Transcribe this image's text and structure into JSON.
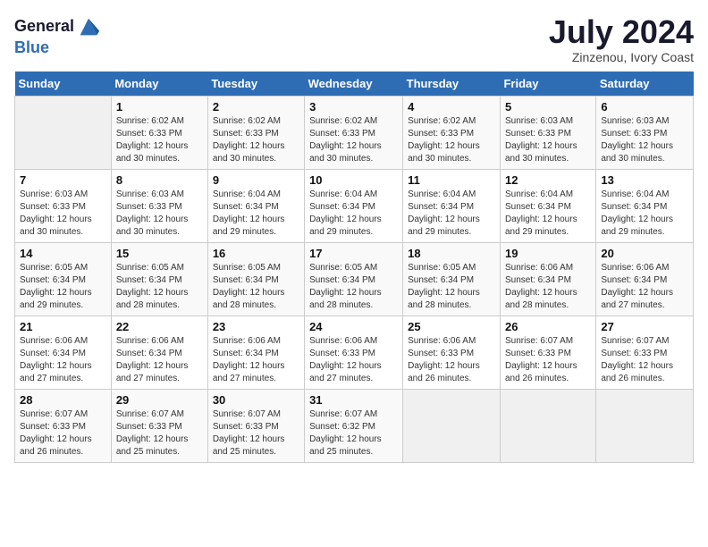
{
  "header": {
    "logo_line1": "General",
    "logo_line2": "Blue",
    "month": "July 2024",
    "location": "Zinzenou, Ivory Coast"
  },
  "days_of_week": [
    "Sunday",
    "Monday",
    "Tuesday",
    "Wednesday",
    "Thursday",
    "Friday",
    "Saturday"
  ],
  "weeks": [
    [
      {
        "day": "",
        "detail": ""
      },
      {
        "day": "1",
        "detail": "Sunrise: 6:02 AM\nSunset: 6:33 PM\nDaylight: 12 hours\nand 30 minutes."
      },
      {
        "day": "2",
        "detail": "Sunrise: 6:02 AM\nSunset: 6:33 PM\nDaylight: 12 hours\nand 30 minutes."
      },
      {
        "day": "3",
        "detail": "Sunrise: 6:02 AM\nSunset: 6:33 PM\nDaylight: 12 hours\nand 30 minutes."
      },
      {
        "day": "4",
        "detail": "Sunrise: 6:02 AM\nSunset: 6:33 PM\nDaylight: 12 hours\nand 30 minutes."
      },
      {
        "day": "5",
        "detail": "Sunrise: 6:03 AM\nSunset: 6:33 PM\nDaylight: 12 hours\nand 30 minutes."
      },
      {
        "day": "6",
        "detail": "Sunrise: 6:03 AM\nSunset: 6:33 PM\nDaylight: 12 hours\nand 30 minutes."
      }
    ],
    [
      {
        "day": "7",
        "detail": "Sunrise: 6:03 AM\nSunset: 6:33 PM\nDaylight: 12 hours\nand 30 minutes."
      },
      {
        "day": "8",
        "detail": "Sunrise: 6:03 AM\nSunset: 6:33 PM\nDaylight: 12 hours\nand 30 minutes."
      },
      {
        "day": "9",
        "detail": "Sunrise: 6:04 AM\nSunset: 6:34 PM\nDaylight: 12 hours\nand 29 minutes."
      },
      {
        "day": "10",
        "detail": "Sunrise: 6:04 AM\nSunset: 6:34 PM\nDaylight: 12 hours\nand 29 minutes."
      },
      {
        "day": "11",
        "detail": "Sunrise: 6:04 AM\nSunset: 6:34 PM\nDaylight: 12 hours\nand 29 minutes."
      },
      {
        "day": "12",
        "detail": "Sunrise: 6:04 AM\nSunset: 6:34 PM\nDaylight: 12 hours\nand 29 minutes."
      },
      {
        "day": "13",
        "detail": "Sunrise: 6:04 AM\nSunset: 6:34 PM\nDaylight: 12 hours\nand 29 minutes."
      }
    ],
    [
      {
        "day": "14",
        "detail": "Sunrise: 6:05 AM\nSunset: 6:34 PM\nDaylight: 12 hours\nand 29 minutes."
      },
      {
        "day": "15",
        "detail": "Sunrise: 6:05 AM\nSunset: 6:34 PM\nDaylight: 12 hours\nand 28 minutes."
      },
      {
        "day": "16",
        "detail": "Sunrise: 6:05 AM\nSunset: 6:34 PM\nDaylight: 12 hours\nand 28 minutes."
      },
      {
        "day": "17",
        "detail": "Sunrise: 6:05 AM\nSunset: 6:34 PM\nDaylight: 12 hours\nand 28 minutes."
      },
      {
        "day": "18",
        "detail": "Sunrise: 6:05 AM\nSunset: 6:34 PM\nDaylight: 12 hours\nand 28 minutes."
      },
      {
        "day": "19",
        "detail": "Sunrise: 6:06 AM\nSunset: 6:34 PM\nDaylight: 12 hours\nand 28 minutes."
      },
      {
        "day": "20",
        "detail": "Sunrise: 6:06 AM\nSunset: 6:34 PM\nDaylight: 12 hours\nand 27 minutes."
      }
    ],
    [
      {
        "day": "21",
        "detail": "Sunrise: 6:06 AM\nSunset: 6:34 PM\nDaylight: 12 hours\nand 27 minutes."
      },
      {
        "day": "22",
        "detail": "Sunrise: 6:06 AM\nSunset: 6:34 PM\nDaylight: 12 hours\nand 27 minutes."
      },
      {
        "day": "23",
        "detail": "Sunrise: 6:06 AM\nSunset: 6:34 PM\nDaylight: 12 hours\nand 27 minutes."
      },
      {
        "day": "24",
        "detail": "Sunrise: 6:06 AM\nSunset: 6:33 PM\nDaylight: 12 hours\nand 27 minutes."
      },
      {
        "day": "25",
        "detail": "Sunrise: 6:06 AM\nSunset: 6:33 PM\nDaylight: 12 hours\nand 26 minutes."
      },
      {
        "day": "26",
        "detail": "Sunrise: 6:07 AM\nSunset: 6:33 PM\nDaylight: 12 hours\nand 26 minutes."
      },
      {
        "day": "27",
        "detail": "Sunrise: 6:07 AM\nSunset: 6:33 PM\nDaylight: 12 hours\nand 26 minutes."
      }
    ],
    [
      {
        "day": "28",
        "detail": "Sunrise: 6:07 AM\nSunset: 6:33 PM\nDaylight: 12 hours\nand 26 minutes."
      },
      {
        "day": "29",
        "detail": "Sunrise: 6:07 AM\nSunset: 6:33 PM\nDaylight: 12 hours\nand 25 minutes."
      },
      {
        "day": "30",
        "detail": "Sunrise: 6:07 AM\nSunset: 6:33 PM\nDaylight: 12 hours\nand 25 minutes."
      },
      {
        "day": "31",
        "detail": "Sunrise: 6:07 AM\nSunset: 6:32 PM\nDaylight: 12 hours\nand 25 minutes."
      },
      {
        "day": "",
        "detail": ""
      },
      {
        "day": "",
        "detail": ""
      },
      {
        "day": "",
        "detail": ""
      }
    ]
  ]
}
